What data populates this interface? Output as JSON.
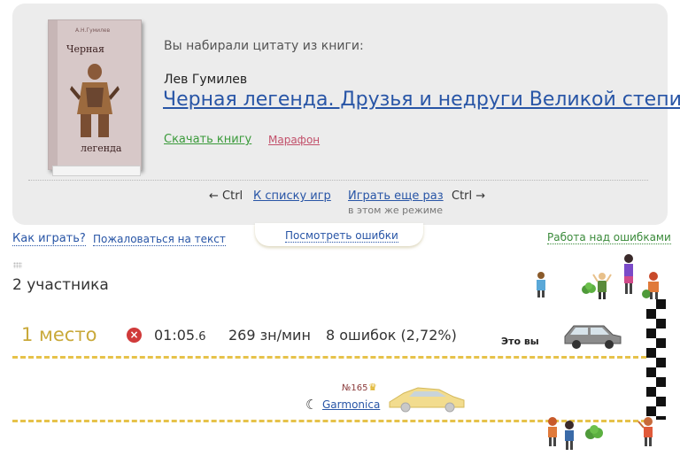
{
  "book": {
    "cover_author": "А.Н.Гумилев",
    "cover_title_1": "Черная",
    "cover_title_2": "легенда",
    "typed_label": "Вы набирали цитату из книги:",
    "author": "Лев Гумилев",
    "title": "Черная легенда. Друзья и недруги Великой степи",
    "download_label": "Скачать книгу",
    "mode_label": "Марафон"
  },
  "nav": {
    "back_shortcut": "← Ctrl",
    "back_label": "К списку игр",
    "again_label": "Играть еще раз",
    "again_sub": "в этом же режиме",
    "again_shortcut": "Ctrl →"
  },
  "links": {
    "how_to_play": "Как играть?",
    "complain": "Пожаловаться на текст",
    "view_errors": "Посмотреть ошибки",
    "work_on_errors": "Работа над ошибками"
  },
  "race": {
    "participants": "2 участника",
    "place": "1 место",
    "time_main": "01:05",
    "time_frac": ".6",
    "speed": "269 зн/мин",
    "errors": "8 ошибок (2,72%)",
    "you_label": "Это вы",
    "opponent_rank": "№165",
    "opponent_name": "Garmonica"
  },
  "colors": {
    "link": "#2855a6",
    "download": "#3a9a3a",
    "mode": "#c2506a",
    "place": "#c9a93a",
    "lane": "#e6c24a",
    "error_icon": "#d03a3a"
  }
}
